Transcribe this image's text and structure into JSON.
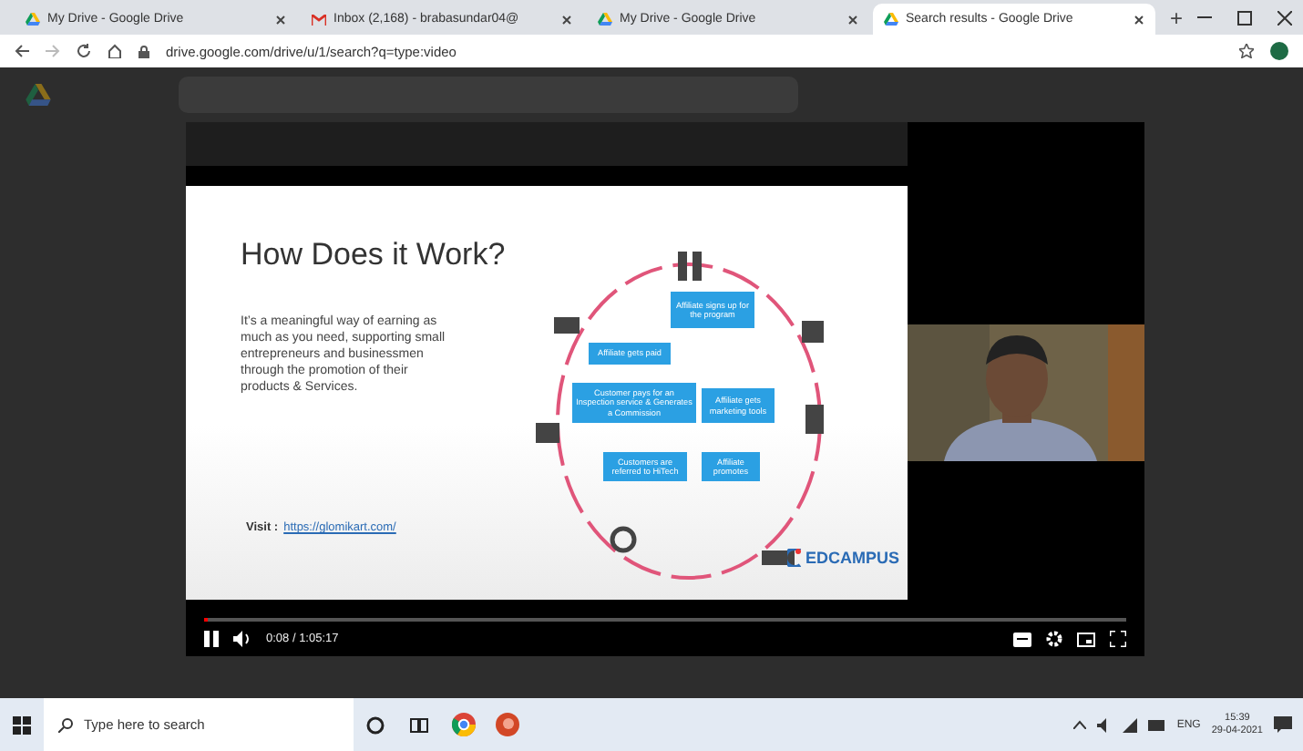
{
  "browser": {
    "tabs": [
      {
        "title": "My Drive - Google Drive",
        "kind": "drive",
        "selected": false
      },
      {
        "title": "Inbox (2,168) - brabasundar04@",
        "kind": "mail",
        "selected": false
      },
      {
        "title": "My Drive - Google Drive",
        "kind": "drive",
        "selected": false
      },
      {
        "title": "Search results - Google Drive",
        "kind": "drive",
        "selected": true
      }
    ],
    "new_tab": "+",
    "address": "drive.google.com/drive/u/1/search?q=type:video"
  },
  "player": {
    "slide": {
      "title": "How Does it Work?",
      "body": "It’s a meaningful way of  earning as much as you need, supporting small entrepreneurs and businessmen through the promotion of their products & Services.",
      "visit_label": "Visit :",
      "link": "https://glomikart.com/",
      "steps": [
        {
          "text": "Affiliate signs up for the program"
        },
        {
          "text": "Affiliate gets paid"
        },
        {
          "text": "Customer pays for an Inspection service & Generates a Commission"
        },
        {
          "text": "Affiliate gets marketing tools"
        },
        {
          "text": "Customers are referred to HiTech"
        },
        {
          "text": "Affiliate promotes"
        }
      ],
      "brand": "EDCAMPUS"
    },
    "playing": true,
    "time": "0:08 / 1:05:17",
    "level": 0.004
  },
  "taskbar": {
    "search_placeholder": "Type here to search",
    "language": "ENG",
    "time": "15:39",
    "date": "29-04-2021"
  }
}
